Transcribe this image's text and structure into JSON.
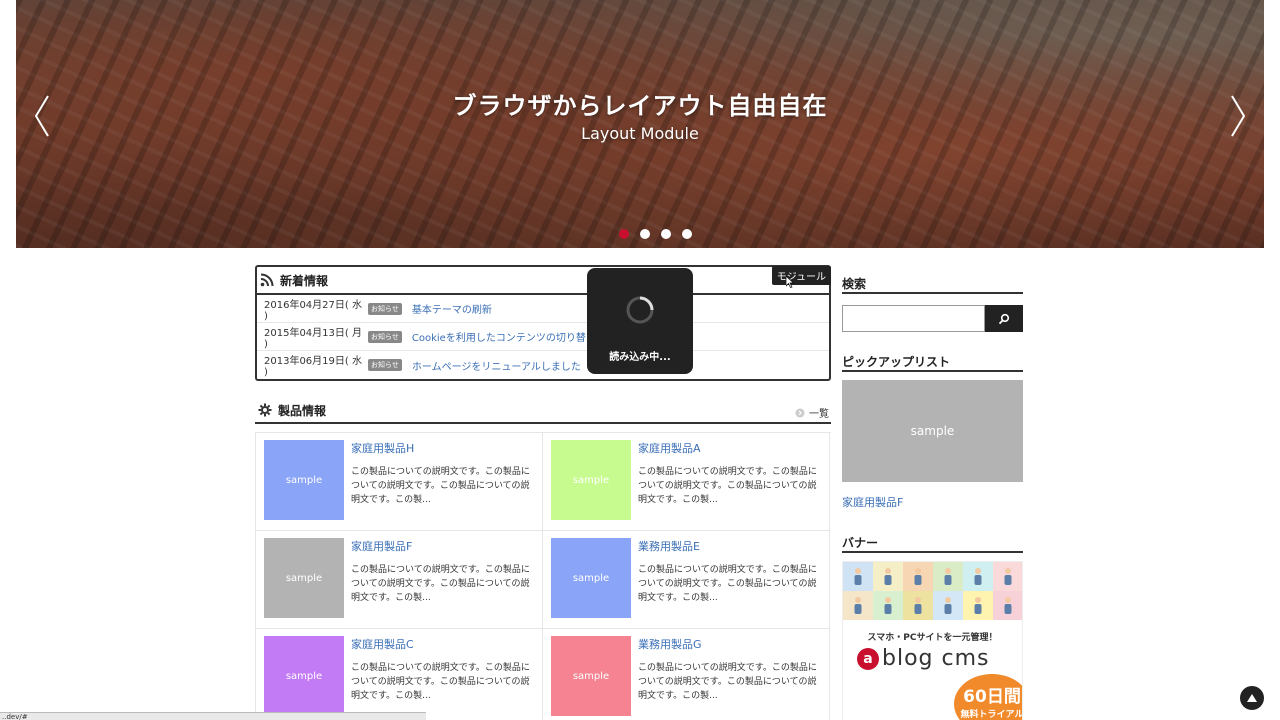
{
  "hero": {
    "title": "ブラウザからレイアウト自由自在",
    "subtitle": "Layout Module",
    "slides_total": 4,
    "active_slide": 1
  },
  "news": {
    "title": "新着情報",
    "module_tag": "モジュール",
    "badge": "お知らせ",
    "items": [
      {
        "date": "2016年04月27日( 水 )",
        "title": "基本テーマの刷新"
      },
      {
        "date": "2015年04月13日( 月 )",
        "title": "Cookieを利用したコンテンツの切り替え"
      },
      {
        "date": "2013年06月19日( 水 )",
        "title": "ホームページをリニューアルしました"
      }
    ]
  },
  "loading": {
    "text": "読み込み中..."
  },
  "products": {
    "title": "製品情報",
    "more_label": "一覧",
    "items": [
      {
        "name": "家庭用製品H",
        "thumb": "sample",
        "color": "#8aa4f7",
        "desc": "この製品についての説明文です。この製品についての説明文です。この製品についての説明文です。この製..."
      },
      {
        "name": "家庭用製品A",
        "thumb": "sample",
        "color": "#c7fb8f",
        "desc": "この製品についての説明文です。この製品についての説明文です。この製品についての説明文です。この製..."
      },
      {
        "name": "家庭用製品F",
        "thumb": "sample",
        "color": "#b3b3b3",
        "desc": "この製品についての説明文です。この製品についての説明文です。この製品についての説明文です。この製..."
      },
      {
        "name": "業務用製品E",
        "thumb": "sample",
        "color": "#8aa4f7",
        "desc": "この製品についての説明文です。この製品についての説明文です。この製品についての説明文です。この製..."
      },
      {
        "name": "家庭用製品C",
        "thumb": "sample",
        "color": "#c27af5",
        "desc": "この製品についての説明文です。この製品についての説明文です。この製品についての説明文です。この製..."
      },
      {
        "name": "業務用製品G",
        "thumb": "sample",
        "color": "#f58391",
        "desc": "この製品についての説明文です。この製品についての説明文です。この製品についての説明文です。この製..."
      }
    ]
  },
  "sidebar": {
    "search_title": "検索",
    "search_value": "",
    "pickup_title": "ピックアップリスト",
    "pickup_thumb": "sample",
    "pickup_link": "家庭用製品F",
    "banner_title": "バナー",
    "banner_copy": "スマホ・PCサイトを一元管理！",
    "banner_logo": "blog cms",
    "banner_logo_mark": "a",
    "banner_badge_big": "60日間",
    "banner_badge_small": "無料トライアル"
  },
  "status_bar": {
    "url": "..dev/#"
  },
  "colors": {
    "accent_red": "#c8102e",
    "link_blue": "#3b6fb6",
    "dark": "#222222"
  }
}
